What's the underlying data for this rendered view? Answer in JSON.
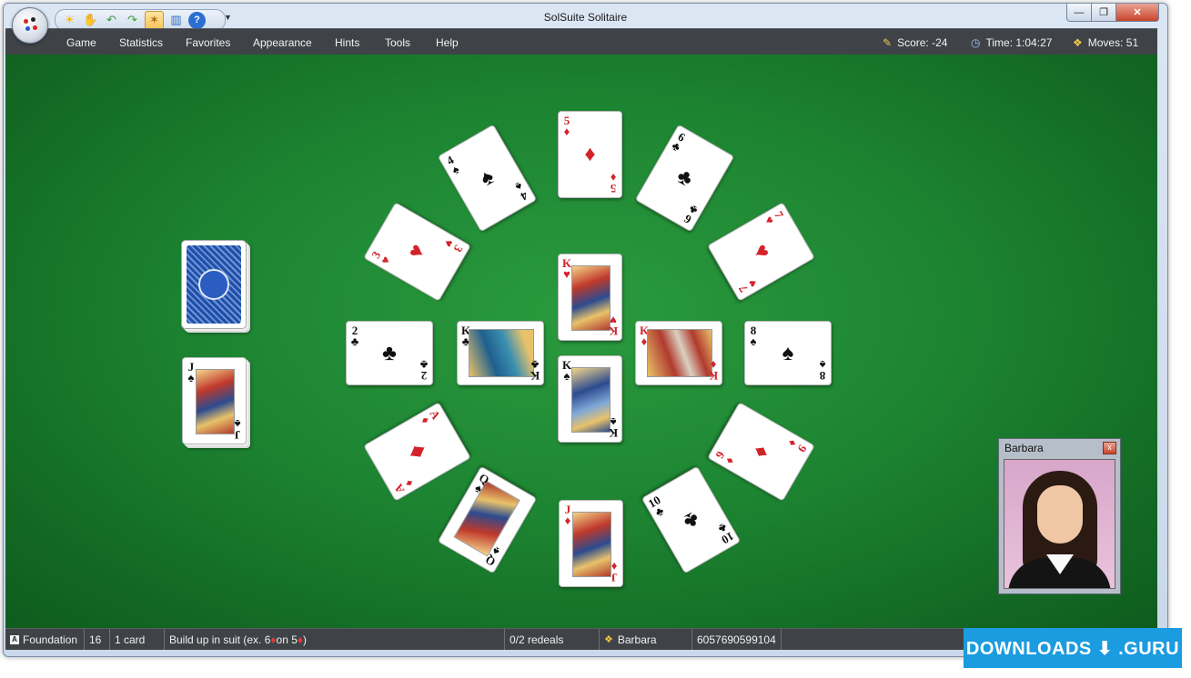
{
  "window": {
    "title": "SolSuite Solitaire"
  },
  "qat": {
    "icons": [
      "sun-icon",
      "hand-icon",
      "undo-icon",
      "redo-icon",
      "hint-icon",
      "stats-icon",
      "help-icon"
    ]
  },
  "menu": [
    "Game",
    "Statistics",
    "Favorites",
    "Appearance",
    "Hints",
    "Tools",
    "Help"
  ],
  "stats": {
    "score": "Score:  -24",
    "time": "Time:  1:04:27",
    "moves": "Moves:  51"
  },
  "cards": {
    "c5d": {
      "rank": "5",
      "suit": "♦"
    },
    "c6c": {
      "rank": "6",
      "suit": "♣"
    },
    "c7h": {
      "rank": "7",
      "suit": "♥"
    },
    "c8s": {
      "rank": "8",
      "suit": "♠"
    },
    "c9d": {
      "rank": "9",
      "suit": "♦"
    },
    "c10c": {
      "rank": "10",
      "suit": "♣"
    },
    "cJd": {
      "rank": "J",
      "suit": "♦"
    },
    "cQs": {
      "rank": "Q",
      "suit": "♠"
    },
    "cAd": {
      "rank": "A",
      "suit": "♦"
    },
    "c2c": {
      "rank": "2",
      "suit": "♣"
    },
    "c3h": {
      "rank": "3",
      "suit": "♥"
    },
    "c4s": {
      "rank": "4",
      "suit": "♠"
    },
    "kh": {
      "rank": "K",
      "suit": "♥"
    },
    "ks": {
      "rank": "K",
      "suit": "♠"
    },
    "kc": {
      "rank": "K",
      "suit": "♣"
    },
    "kd": {
      "rank": "K",
      "suit": "♦"
    },
    "waste": {
      "rank": "J",
      "suit": "♠"
    }
  },
  "player": {
    "name": "Barbara",
    "close": "x"
  },
  "status": {
    "pile_icon": "A",
    "pile": "Foundation",
    "count": "16",
    "cards": "1 card",
    "rule_prefix": "Build up in suit (ex. 6 ",
    "rule_suit1": "♦",
    "rule_middle": " on 5 ",
    "rule_suit2": "♦",
    "rule_suffix": ")",
    "redeals": "0/2 redeals",
    "player": "Barbara",
    "seed": "6057690599104"
  },
  "watermark": "DOWNLOADS ⬇ .GURU"
}
